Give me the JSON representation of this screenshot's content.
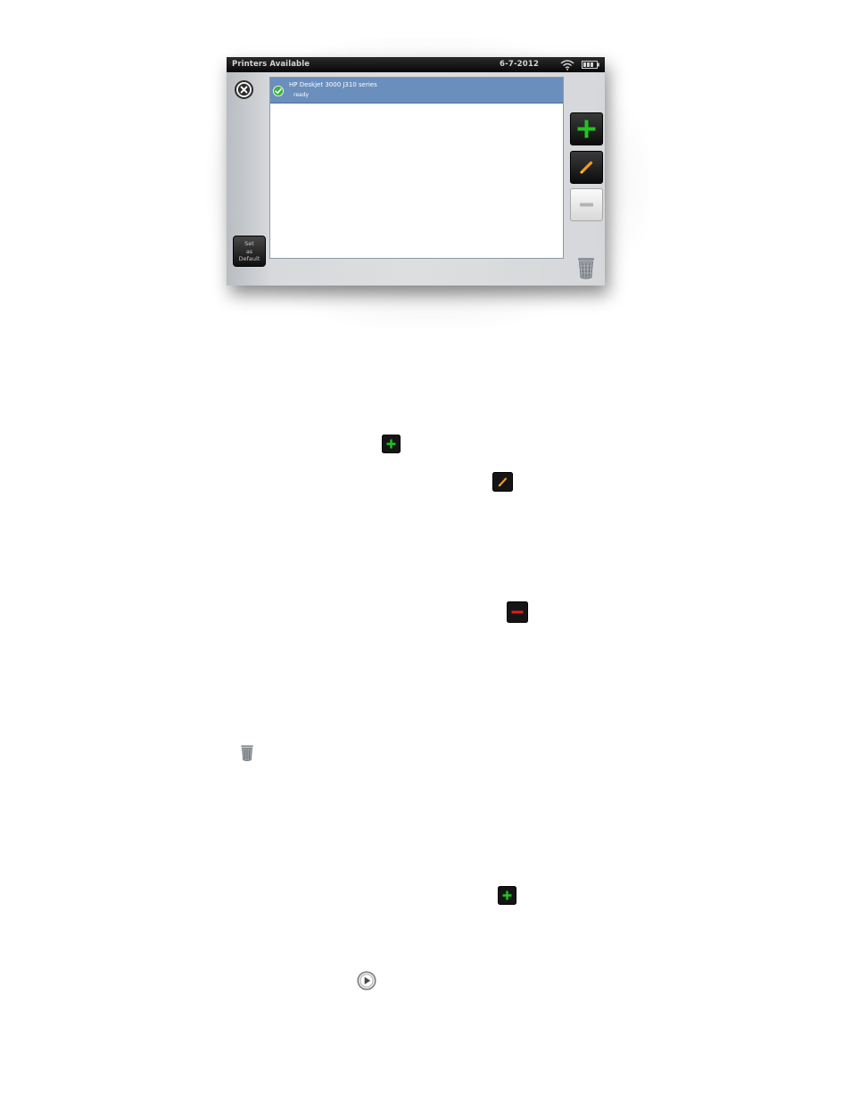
{
  "screen": {
    "status_bar": {
      "title": "Printers Available",
      "date": "6-7-2012"
    },
    "printers": [
      {
        "name": "HP Deskjet 3000 J310 series",
        "status": "ready",
        "selected": true
      }
    ],
    "buttons": {
      "set_default_label_line1": "Set",
      "set_default_label_line2": "as",
      "set_default_label_line3": "Default"
    }
  },
  "icons": {
    "close": "close-icon",
    "wifi": "wifi-icon",
    "battery": "battery-icon",
    "check": "check-icon",
    "add": "plus-icon",
    "edit": "pencil-icon",
    "remove": "minus-icon",
    "trash": "trash-icon",
    "play": "play-icon"
  },
  "colors": {
    "selection": "#6a8fbd",
    "add_green": "#22c322",
    "edit_orange": "#f29a1c",
    "remove_red": "#d81f1f",
    "status_bar": "#111111"
  }
}
